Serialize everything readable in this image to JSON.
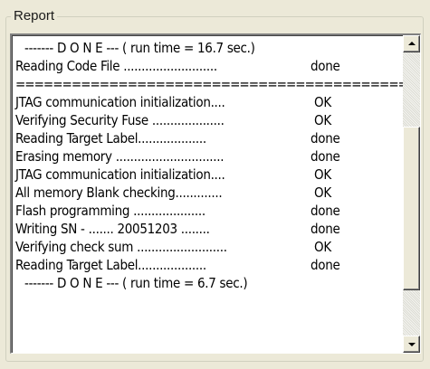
{
  "report": {
    "title": "Report",
    "lines": [
      {
        "kind": "done",
        "text": "------- D O N E --- ( run time =  16.7 sec.)"
      },
      {
        "kind": "row",
        "label": "Reading Code File ..........................",
        "status": "done"
      },
      {
        "kind": "separator",
        "text": "================================================"
      },
      {
        "kind": "row",
        "label": "JTAG communication initialization....",
        "status": "OK"
      },
      {
        "kind": "row",
        "label": "Verifying Security Fuse ....................",
        "status": "OK"
      },
      {
        "kind": "row",
        "label": "Reading Target Label...................",
        "status": "done"
      },
      {
        "kind": "row",
        "label": "Erasing memory ..............................",
        "status": "done"
      },
      {
        "kind": "row",
        "label": "JTAG communication initialization....",
        "status": "OK"
      },
      {
        "kind": "row",
        "label": "All memory Blank checking.............",
        "status": "OK"
      },
      {
        "kind": "row",
        "label": "Flash programming ....................",
        "status": "done"
      },
      {
        "kind": "row",
        "label": "Writing SN - ....... 20051203  ........",
        "status": "done"
      },
      {
        "kind": "row",
        "label": "Verifying check sum .........................",
        "status": "OK"
      },
      {
        "kind": "row",
        "label": "Reading Target Label...................",
        "status": "done"
      },
      {
        "kind": "done",
        "text": "------- D O N E --- ( run time =   6.7 sec.)"
      }
    ]
  },
  "scrollbar": {
    "up_icon": "arrow-up-icon",
    "down_icon": "arrow-down-icon",
    "position_fraction": 0.62
  }
}
